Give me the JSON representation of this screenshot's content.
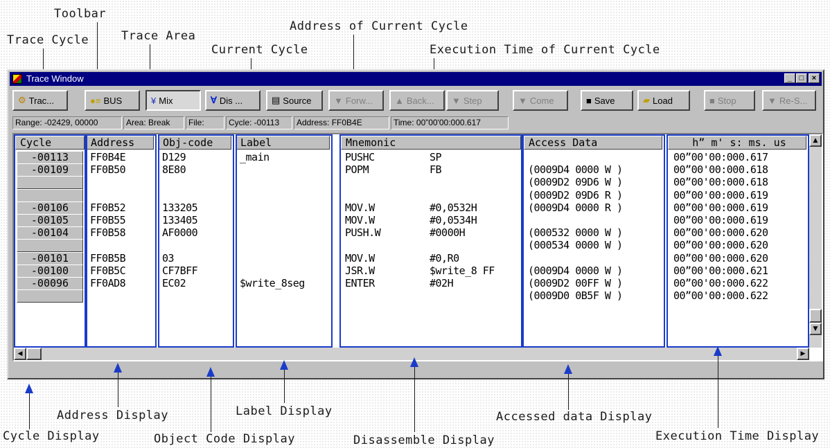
{
  "annotations": {
    "toolbar": "Toolbar",
    "trace_cycle": "Trace Cycle",
    "trace_area": "Trace Area",
    "current_cycle": "Current Cycle",
    "address_current_cycle": "Address of Current Cycle",
    "exec_time_current_cycle": "Execution Time of Current Cycle",
    "address_display": "Address Display",
    "cycle_display": "Cycle Display",
    "object_code_display": "Object Code Display",
    "label_display": "Label Display",
    "disassemble_display": "Disassemble Display",
    "accessed_data_display": "Accessed data Display",
    "execution_time_display": "Execution Time Display"
  },
  "window": {
    "title": "Trace Window",
    "minimize": "_",
    "maximize": "□",
    "close": "×"
  },
  "toolbar": {
    "buttons": [
      {
        "label": "Trac...",
        "icon": "trace-icon"
      },
      {
        "label": "BUS",
        "icon": "bus-icon"
      },
      {
        "label": "Mix",
        "icon": "mix-icon"
      },
      {
        "label": "Dis ...",
        "icon": "disassemble-icon"
      },
      {
        "label": "Source",
        "icon": "source-icon"
      },
      {
        "label": "Forw...",
        "icon": "forward-icon"
      },
      {
        "label": "Back...",
        "icon": "back-icon"
      },
      {
        "label": "Step",
        "icon": "step-icon"
      },
      {
        "label": "Come",
        "icon": "come-icon"
      },
      {
        "label": "Save",
        "icon": "save-icon"
      },
      {
        "label": "Load",
        "icon": "load-icon"
      },
      {
        "label": "Stop",
        "icon": "stop-icon"
      },
      {
        "label": "Re-S...",
        "icon": "research-icon"
      }
    ]
  },
  "status": {
    "range": "Range: -02429, 00000",
    "area": "Area: Break",
    "file": "File:",
    "cycle": "Cycle: -00113",
    "address": "Address: FF0B4E",
    "time": "Time: 00”00'00:000.617"
  },
  "columns": {
    "cycle": "Cycle",
    "address": "Address",
    "objcode": "Obj-code",
    "label": "Label",
    "mnemonic": "Mnemonic",
    "access": "Access Data",
    "time": "h” m' s: ms. us"
  },
  "rows": [
    {
      "cycle": "-00113",
      "address": "FF0B4E",
      "objcode": "D129",
      "label": "_main",
      "op": "PUSHC",
      "operand": "SP",
      "access": "",
      "time": "00”00'00:000.617"
    },
    {
      "cycle": "-00109",
      "address": "FF0B50",
      "objcode": "8E80",
      "label": "",
      "op": "POPM",
      "operand": "FB",
      "access": "(0009D4 0000  W )",
      "time": "00”00'00:000.618"
    },
    {
      "cycle": "",
      "address": "",
      "objcode": "",
      "label": "",
      "op": "",
      "operand": "",
      "access": "(0009D2 09D6  W )",
      "time": "00”00'00:000.618"
    },
    {
      "cycle": "",
      "address": "",
      "objcode": "",
      "label": "",
      "op": "",
      "operand": "",
      "access": "(0009D2 09D6  R )",
      "time": "00”00'00:000.619"
    },
    {
      "cycle": "-00106",
      "address": "FF0B52",
      "objcode": "133205",
      "label": "",
      "op": "MOV.W",
      "operand": "#0,0532H",
      "access": "(0009D4 0000  R )",
      "time": "00”00'00:000.619"
    },
    {
      "cycle": "-00105",
      "address": "FF0B55",
      "objcode": "133405",
      "label": "",
      "op": "MOV.W",
      "operand": "#0,0534H",
      "access": "",
      "time": "00”00'00:000.619"
    },
    {
      "cycle": "-00104",
      "address": "FF0B58",
      "objcode": "AF0000",
      "label": "",
      "op": "PUSH.W",
      "operand": "#0000H",
      "access": "(000532 0000  W )",
      "time": "00”00'00:000.620"
    },
    {
      "cycle": "",
      "address": "",
      "objcode": "",
      "label": "",
      "op": "",
      "operand": "",
      "access": "(000534 0000  W )",
      "time": "00”00'00:000.620"
    },
    {
      "cycle": "-00101",
      "address": "FF0B5B",
      "objcode": "03",
      "label": "",
      "op": "MOV.W",
      "operand": "#0,R0",
      "access": "",
      "time": "00”00'00:000.620"
    },
    {
      "cycle": "-00100",
      "address": "FF0B5C",
      "objcode": "CF7BFF",
      "label": "",
      "op": "JSR.W",
      "operand": "$write_8 FF",
      "access": "(0009D4 0000  W )",
      "time": "00”00'00:000.621"
    },
    {
      "cycle": "-00096",
      "address": "FF0AD8",
      "objcode": "EC02",
      "label": "$write_8seg",
      "op": "ENTER",
      "operand": "#02H",
      "access": "(0009D2 00FF  W )",
      "time": "00”00'00:000.622"
    },
    {
      "cycle": "",
      "address": "",
      "objcode": "",
      "label": "",
      "op": "",
      "operand": "",
      "access": "(0009D0 0B5F  W )",
      "time": "00”00'00:000.622"
    }
  ],
  "colors": {
    "title_bar": "#000080",
    "highlight_box": "#1a3cc8",
    "window_face": "#c0c0c0"
  }
}
